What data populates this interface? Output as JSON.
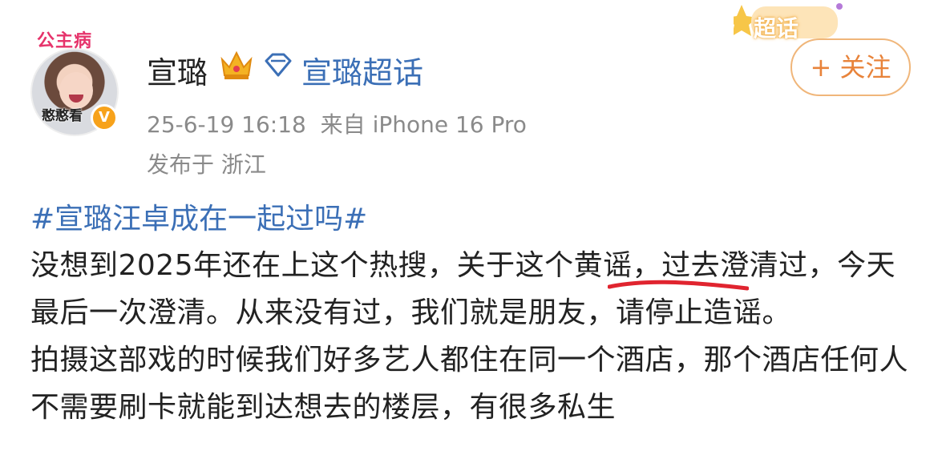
{
  "post": {
    "avatar": {
      "sticker_text": "公主病",
      "caption": "憨憨看"
    },
    "username": "宣璐",
    "supertopic_label": "宣璐超话",
    "chaohua_badge": "超话",
    "follow_label": "+ 关注",
    "time_source": "25-6-19 16:18  来自 iPhone 16 Pro",
    "location": "发布于 浙江",
    "hashtag": "#宣璐汪卓成在一起过吗#",
    "paragraphs": [
      "没想到2025年还在上这个热搜，关于这个黄谣，过去澄清过，今天最后一次澄清。从来没有过，我们就是朋友，请停止造谣。",
      "拍摄这部戏的时候我们好多艺人都住在同一个酒店，那个酒店任何人不需要刷卡就能到达想去的楼层，有很多私生"
    ]
  },
  "colors": {
    "link_blue": "#3b6fb6",
    "follow_orange": "#e8833a",
    "meta_gray": "#8a8a8a",
    "underline_red": "#e0242f",
    "verified_gold": "#f7a21b"
  },
  "icons": [
    "crown-icon",
    "diamond-icon",
    "verified-badge-icon",
    "star-icon"
  ]
}
